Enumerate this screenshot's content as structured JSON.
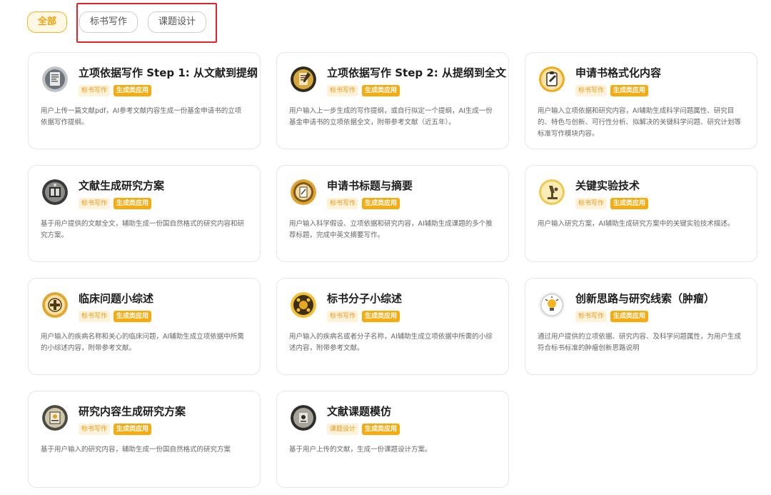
{
  "filters": [
    {
      "label": "全部",
      "active": true
    },
    {
      "label": "标书写作",
      "active": false
    },
    {
      "label": "课题设计",
      "active": false
    }
  ],
  "tags": {
    "generative": "生成类应用"
  },
  "cards": [
    {
      "title": "立项依据写作 Step 1: 从文献到提纲",
      "category": "标书写作",
      "description": "用户上传一篇文献pdf，AI参考文献内容生成一份基金申请书的立项依据写作提纲。",
      "icon": "document-notes-icon"
    },
    {
      "title": "立项依据写作 Step 2: 从提纲到全文",
      "category": "标书写作",
      "description": "用户输入上一步生成的写作提纲，或自行拟定一个提纲，AI生成一份基金申请书的立项依据全文，附带参考文献（近五年）。",
      "icon": "manuscript-icon"
    },
    {
      "title": "申请书格式化内容",
      "category": "标书写作",
      "description": "用户输入立项依据和研究内容，AI辅助生成科学问题属性、研究目的、特色与创新、可行性分析、拟解决的关键科学问题、研究计划等标准写作模块内容。",
      "icon": "clipboard-edit-icon"
    },
    {
      "title": "文献生成研究方案",
      "category": "标书写作",
      "description": "基于用户提供的文献全文，辅助生成一份国自然格式的研究内容和研究方案。",
      "icon": "book-research-icon"
    },
    {
      "title": "申请书标题与摘要",
      "category": "标书写作",
      "description": "用户输入科学假设、立项依据和研究内容，AI辅助生成课题的多个推荐标题，完成中英文摘要写作。",
      "icon": "title-abstract-icon"
    },
    {
      "title": "关键实验技术",
      "category": "标书写作",
      "description": "用户输入研究方案，AI辅助生成研究方案中的关键实验技术描述。",
      "icon": "microscope-icon"
    },
    {
      "title": "临床问题小综述",
      "category": "标书写作",
      "description": "用户输入的疾病名称和关心的临床问题，AI辅助生成立项依据中所需的小综述内容，附带参考文献。",
      "icon": "medical-cross-icon"
    },
    {
      "title": "标书分子小综述",
      "category": "标书写作",
      "description": "用户输入的疾病名或者分子名称，AI辅助生成立项依据中所需的小综述内容，附带参考文献。",
      "icon": "molecule-icon"
    },
    {
      "title": "创新思路与研究线索（肿瘤）",
      "category": "标书写作",
      "description": "通过用户提供的立项依据、研究内容、及科学问题属性，为用户生成符合标书标准的肿瘤创新思路说明",
      "icon": "lightbulb-icon"
    },
    {
      "title": "研究内容生成研究方案",
      "category": "标书写作",
      "description": "基于用户输入的研究内容，辅助生成一份国自然格式的研究方案",
      "icon": "research-plan-icon"
    },
    {
      "title": "文献课题模仿",
      "category": "课题设计",
      "description": "基于用户上传的文献，生成一份课题设计方案。",
      "icon": "topic-design-icon"
    }
  ]
}
